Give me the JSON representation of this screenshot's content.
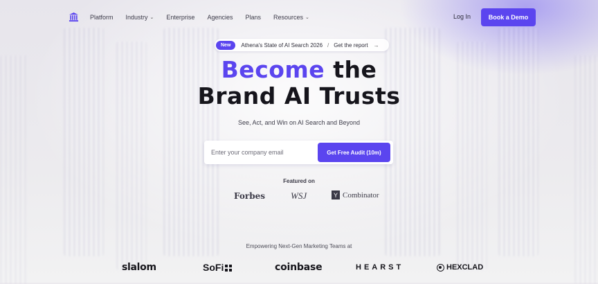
{
  "nav": {
    "logo_icon": "classical-building-icon",
    "links": [
      {
        "label": "Platform",
        "has_dropdown": false
      },
      {
        "label": "Industry",
        "has_dropdown": true
      },
      {
        "label": "Enterprise",
        "has_dropdown": false
      },
      {
        "label": "Agencies",
        "has_dropdown": false
      },
      {
        "label": "Plans",
        "has_dropdown": false
      },
      {
        "label": "Resources",
        "has_dropdown": true
      }
    ],
    "login_label": "Log In",
    "demo_label": "Book a Demo"
  },
  "announcement": {
    "badge": "New",
    "text": "Athena's State of AI Search 2026",
    "separator": "/",
    "cta": "Get the report",
    "arrow": "→"
  },
  "hero": {
    "title_accent": "Become",
    "title_rest_line1": " the",
    "title_line2": "Brand AI Trusts",
    "subtitle": "See, Act, and Win on AI Search and Beyond"
  },
  "form": {
    "email_placeholder": "Enter your company email",
    "email_value": "",
    "submit_label": "Get Free Audit (10m)"
  },
  "featured": {
    "label": "Featured on",
    "outlets": [
      "Forbes",
      "WSJ",
      "Combinator"
    ],
    "yc_mark": "Y"
  },
  "customers": {
    "label": "Empowering Next-Gen Marketing Teams at",
    "logos": [
      "slalom",
      "SoFi",
      "coinbase",
      "HEARST",
      "HEXCLAD"
    ]
  },
  "colors": {
    "accent": "#5b45ef",
    "text_dark": "#16151c",
    "background": "#eceaee"
  }
}
